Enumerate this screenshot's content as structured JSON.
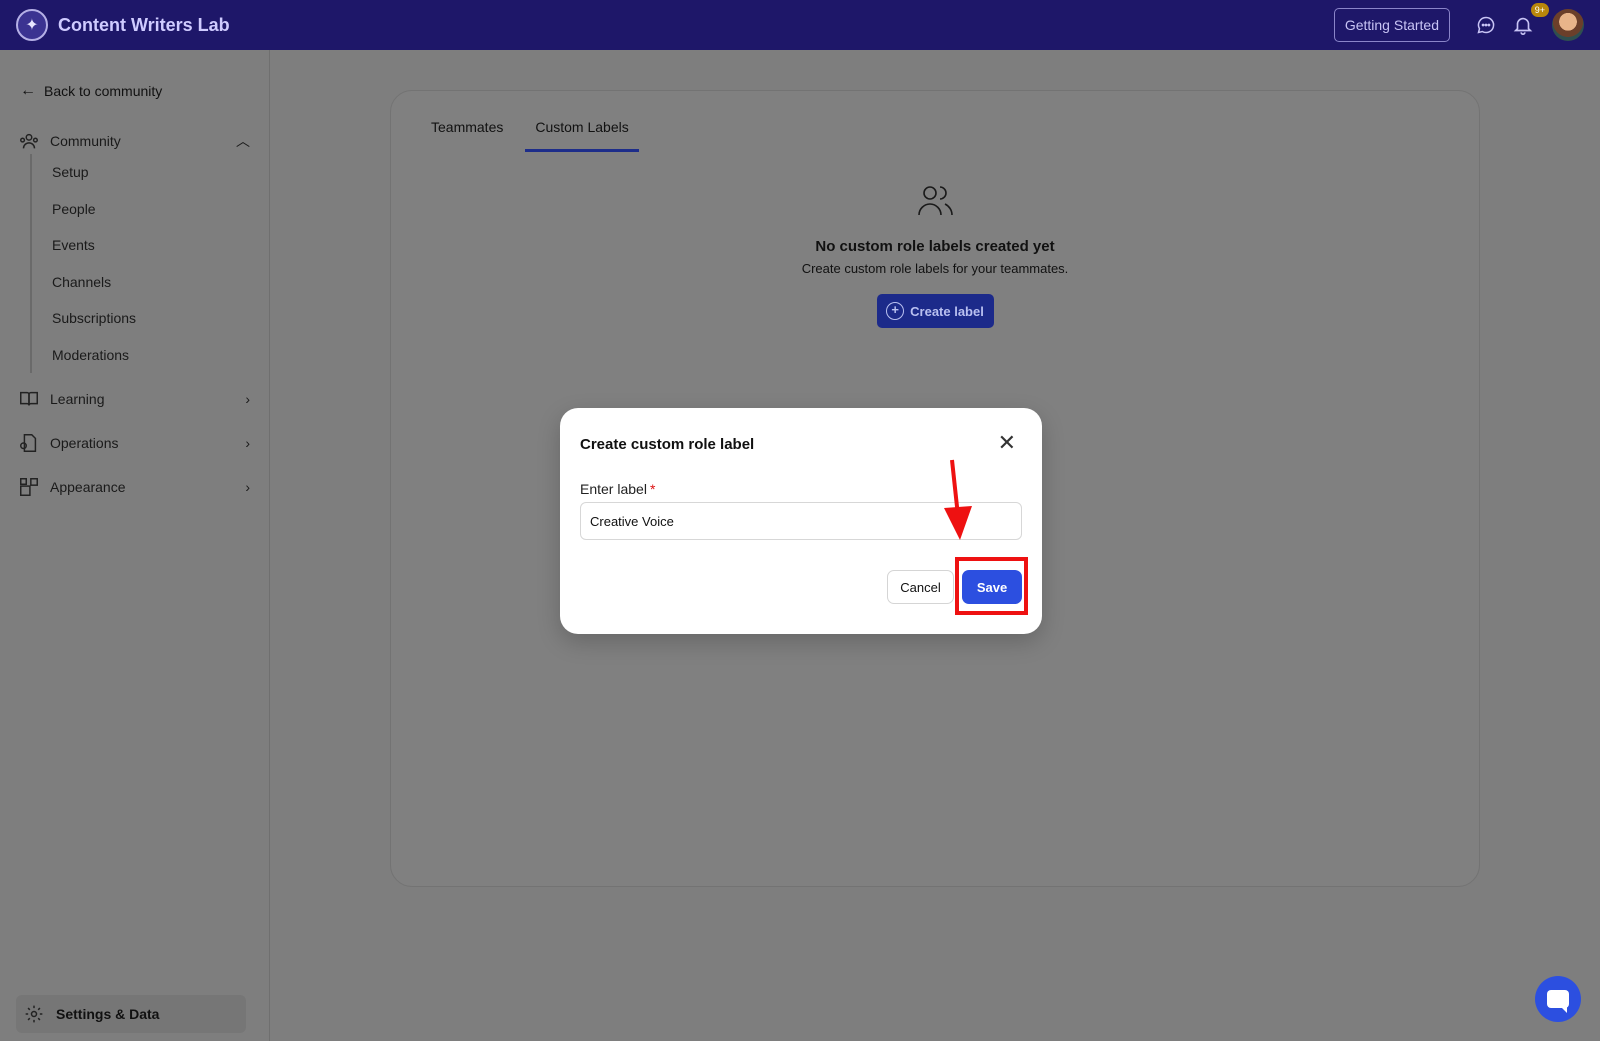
{
  "topbar": {
    "app_title": "Content Writers Lab",
    "getting_started": "Getting Started",
    "notif_badge": "9+"
  },
  "sidebar": {
    "back": "Back to community",
    "community": "Community",
    "subitems": [
      "Setup",
      "People",
      "Events",
      "Channels",
      "Subscriptions",
      "Moderations"
    ],
    "learning": "Learning",
    "operations": "Operations",
    "appearance": "Appearance",
    "settings": "Settings & Data"
  },
  "main": {
    "tabs": [
      "Teammates",
      "Custom Labels"
    ],
    "active_tab": "Custom Labels",
    "empty_title": "No custom role labels created yet",
    "empty_sub": "Create custom role labels for your teammates.",
    "create_label": "Create label"
  },
  "modal": {
    "title": "Create custom role label",
    "field_label": "Enter label",
    "required_mark": "*",
    "field_value": "Creative Voice",
    "cancel": "Cancel",
    "save": "Save"
  },
  "colors": {
    "topbar": "#1e1769",
    "primary": "#2c4fe0",
    "highlight": "#ee1111"
  }
}
